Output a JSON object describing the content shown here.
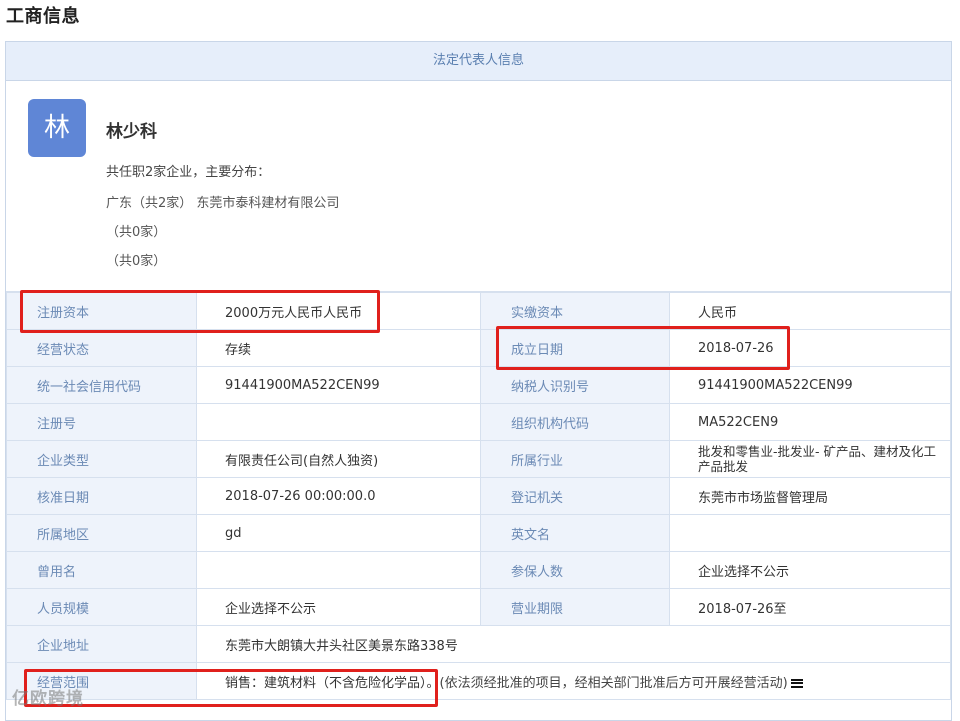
{
  "page": {
    "title": "工商信息"
  },
  "panel": {
    "header": "法定代表人信息"
  },
  "person": {
    "avatar_char": "林",
    "name": "林少科",
    "summary": "共任职2家企业，主要分布：",
    "lines": [
      "广东（共2家） 东莞市泰科建材有限公司",
      "（共0家）",
      "（共0家）"
    ]
  },
  "rows": [
    {
      "k1": "注册资本",
      "v1": "2000万元人民币人民币",
      "k2": "实缴资本",
      "v2": "人民币"
    },
    {
      "k1": "经营状态",
      "v1": "存续",
      "k2": "成立日期",
      "v2": "2018-07-26"
    },
    {
      "k1": "统一社会信用代码",
      "v1": "91441900MA522CEN99",
      "k2": "纳税人识别号",
      "v2": "91441900MA522CEN99"
    },
    {
      "k1": "注册号",
      "v1": "",
      "k2": "组织机构代码",
      "v2": "MA522CEN9"
    },
    {
      "k1": "企业类型",
      "v1": "有限责任公司(自然人独资)",
      "k2": "所属行业",
      "v2": "批发和零售业-批发业- 矿产品、建材及化工产品批发"
    },
    {
      "k1": "核准日期",
      "v1": "2018-07-26 00:00:00.0",
      "k2": "登记机关",
      "v2": "东莞市市场监督管理局"
    },
    {
      "k1": "所属地区",
      "v1": "gd",
      "k2": "英文名",
      "v2": ""
    },
    {
      "k1": "曾用名",
      "v1": "",
      "k2": "参保人数",
      "v2": "企业选择不公示"
    },
    {
      "k1": "人员规模",
      "v1": "企业选择不公示",
      "k2": "营业期限",
      "v2": "2018-07-26至"
    }
  ],
  "address": {
    "k": "企业地址",
    "v": "东莞市大朗镇大井头社区美景东路338号"
  },
  "scope": {
    "k": "经营范围",
    "v": "销售：建筑材料（不含危险化学品）。",
    "note": "(依法须经批准的项目，经相关部门批准后方可开展经营活动)"
  },
  "watermark": "亿欧跨境",
  "colors": {
    "highlight": "#e0201c",
    "header_bg": "#e6eefa",
    "key_bg": "#eef3fb",
    "avatar": "#5f86d6"
  }
}
